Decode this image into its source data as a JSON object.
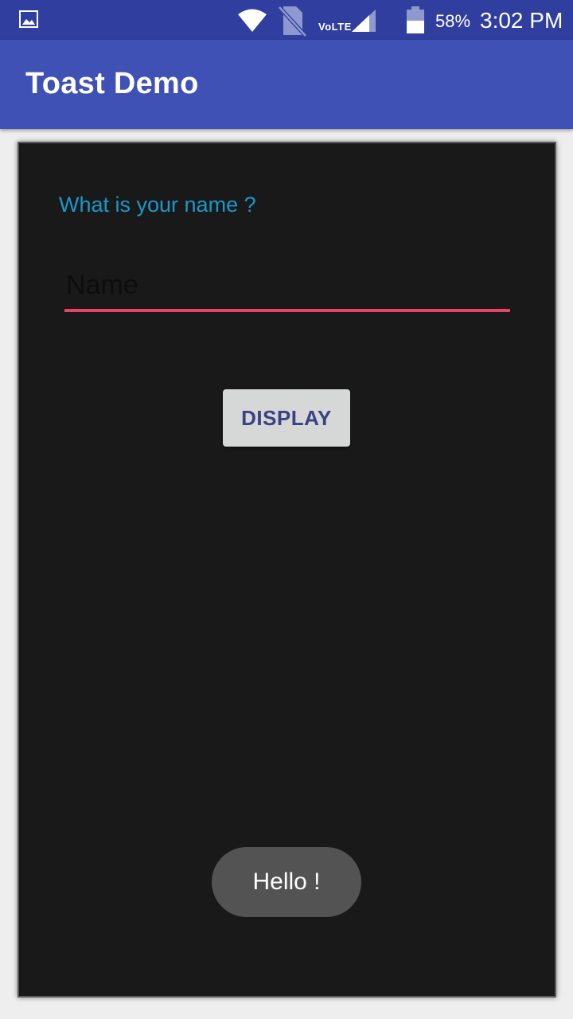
{
  "status_bar": {
    "volte": "VoLTE",
    "battery_percent": "58%",
    "battery_level": 0.58,
    "time": "3:02 PM",
    "icons": [
      "gallery-icon",
      "wifi-icon",
      "no-sim-icon",
      "signal-icon",
      "battery-icon"
    ]
  },
  "app_bar": {
    "title": "Toast Demo",
    "color": "#3f51b5"
  },
  "form": {
    "question": "What is your name ?",
    "name_placeholder": "Name",
    "name_value": "",
    "display_button": "DISPLAY"
  },
  "toast": {
    "message": "Hello  !"
  },
  "colors": {
    "status_bar": "#303f9f",
    "accent": "#e8416e",
    "question_text": "#1a98cc",
    "background": "#191919"
  }
}
